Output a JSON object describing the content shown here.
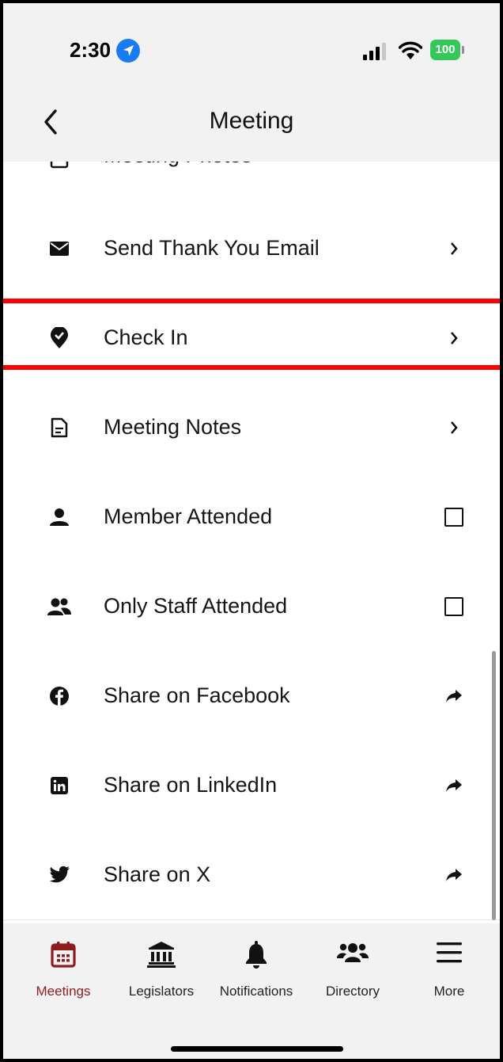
{
  "status_bar": {
    "time": "2:30",
    "battery": "100"
  },
  "header": {
    "title": "Meeting"
  },
  "list": {
    "partial_item": "Meeting Photos",
    "items": [
      {
        "label": "Send Thank You Email",
        "icon": "envelope-icon",
        "trailing": "chevron-right"
      },
      {
        "label": "Check In",
        "icon": "location-check-icon",
        "trailing": "chevron-right"
      },
      {
        "label": "Meeting Notes",
        "icon": "document-icon",
        "trailing": "chevron-right"
      },
      {
        "label": "Member Attended",
        "icon": "person-icon",
        "trailing": "checkbox",
        "checked": false
      },
      {
        "label": "Only Staff Attended",
        "icon": "people-icon",
        "trailing": "checkbox",
        "checked": false
      },
      {
        "label": "Share on Facebook",
        "icon": "facebook-icon",
        "trailing": "share-arrow"
      },
      {
        "label": "Share on LinkedIn",
        "icon": "linkedin-icon",
        "trailing": "share-arrow"
      },
      {
        "label": "Share on X",
        "icon": "twitter-icon",
        "trailing": "share-arrow"
      }
    ]
  },
  "tab_bar": {
    "tabs": [
      {
        "label": "Meetings",
        "icon": "calendar-icon",
        "active": true
      },
      {
        "label": "Legislators",
        "icon": "institution-icon",
        "active": false
      },
      {
        "label": "Notifications",
        "icon": "bell-icon",
        "active": false
      },
      {
        "label": "Directory",
        "icon": "users-icon",
        "active": false
      },
      {
        "label": "More",
        "icon": "menu-icon",
        "active": false
      }
    ]
  },
  "colors": {
    "accent": "#8d1d1d",
    "highlight": "#ff0000",
    "battery": "#35c759",
    "location": "#1a7cf5"
  }
}
